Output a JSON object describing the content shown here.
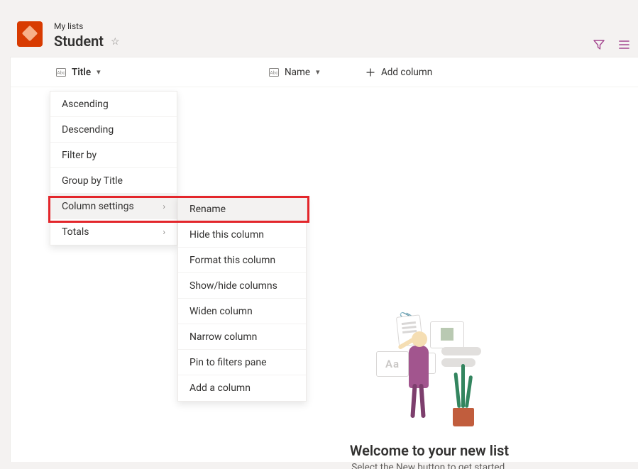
{
  "header": {
    "breadcrumb": "My lists",
    "title": "Student"
  },
  "columns": {
    "title_label": "Title",
    "name_label": "Name",
    "add_label": "Add column"
  },
  "menu": {
    "items": [
      {
        "label": "Ascending",
        "has_submenu": false
      },
      {
        "label": "Descending",
        "has_submenu": false
      },
      {
        "label": "Filter by",
        "has_submenu": false
      },
      {
        "label": "Group by Title",
        "has_submenu": false
      },
      {
        "label": "Column settings",
        "has_submenu": true,
        "selected": true
      },
      {
        "label": "Totals",
        "has_submenu": true
      }
    ]
  },
  "submenu": {
    "items": [
      {
        "label": "Rename",
        "highlighted": true
      },
      {
        "label": "Hide this column"
      },
      {
        "label": "Format this column"
      },
      {
        "label": "Show/hide columns"
      },
      {
        "label": "Widen column"
      },
      {
        "label": "Narrow column"
      },
      {
        "label": "Pin to filters pane"
      },
      {
        "label": "Add a column"
      }
    ]
  },
  "empty_state": {
    "heading": "Welcome to your new list",
    "subtext": "Select the New button to get started."
  }
}
